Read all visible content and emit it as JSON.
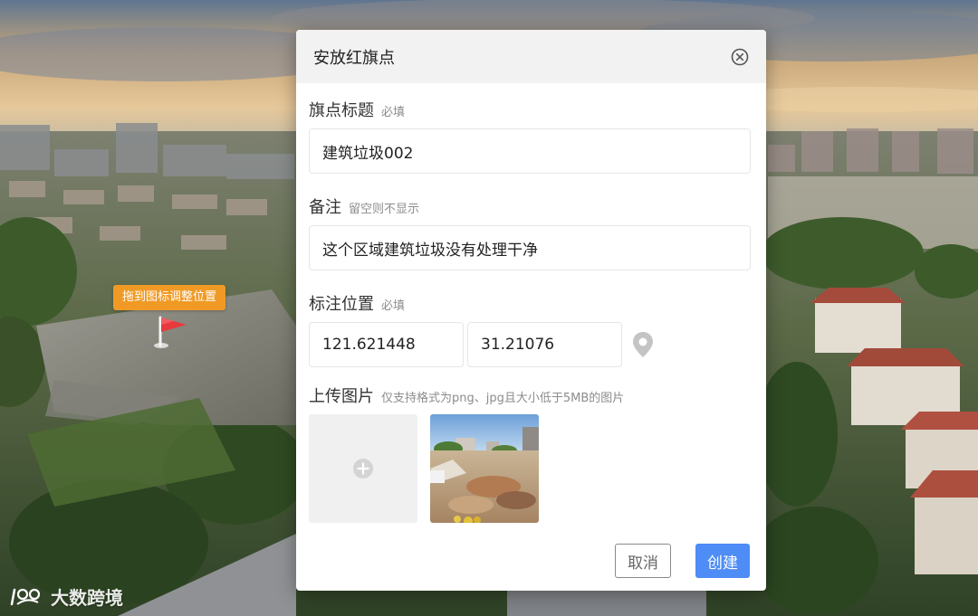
{
  "dialog": {
    "title": "安放红旗点",
    "close_icon": "close-circle-icon"
  },
  "fields": {
    "title": {
      "label": "旗点标题",
      "hint": "必填",
      "value": "建筑垃圾002"
    },
    "remark": {
      "label": "备注",
      "hint": "留空则不显示",
      "value": "这个区域建筑垃圾没有处理干净"
    },
    "position": {
      "label": "标注位置",
      "hint": "必填",
      "longitude": "121.621448",
      "latitude": "31.21076",
      "locate_icon": "map-pin-icon"
    },
    "upload": {
      "label": "上传图片",
      "hint": "仅支持格式为png、jpg且大小低于5MB的图片",
      "add_icon": "plus-circle-icon"
    }
  },
  "buttons": {
    "cancel": "取消",
    "create": "创建"
  },
  "scene": {
    "drag_tip": "拖到图标调整位置",
    "flag_icon": "red-flag-icon",
    "flag_color": "#e8393d",
    "tip_color": "#f09a25"
  },
  "watermark": {
    "text": "大数跨境",
    "logo_icon": "logo-icon"
  },
  "colors": {
    "primary": "#4e8cf6",
    "header_bg": "#f2f2f2"
  }
}
